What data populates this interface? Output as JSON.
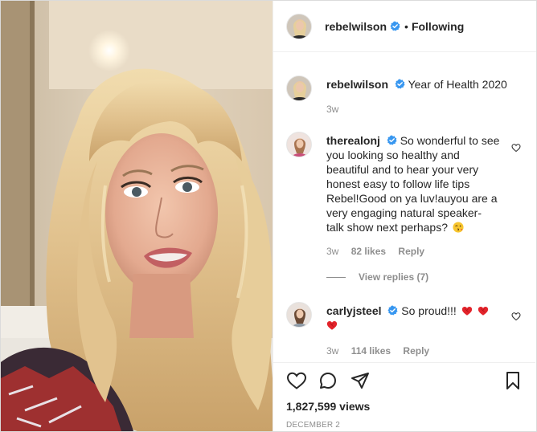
{
  "header": {
    "username": "rebelwilson",
    "separator": "•",
    "follow_label": "Following"
  },
  "caption": {
    "username": "rebelwilson",
    "text": "Year of Health 2020",
    "time": "3w"
  },
  "comments": [
    {
      "username": "therealonj",
      "text": "So wonderful to see you looking so healthy and beautiful and to hear your very honest easy to follow life tips Rebel!Good on ya luv!auyou are a very engaging natural speaker- talk show next perhaps?",
      "emoji": "winking-kiss-emoji",
      "time": "3w",
      "likes": "82 likes",
      "reply": "Reply",
      "view_replies": "View replies (7)"
    },
    {
      "username": "carlyjsteel",
      "text": "So proud!!!",
      "emoji": "red-heart-emoji",
      "time": "3w",
      "likes": "114 likes",
      "reply": "Reply"
    }
  ],
  "stats": {
    "views": "1,827,599 views",
    "date": "DECEMBER 2"
  },
  "colors": {
    "verified_blue": "#3897f0",
    "text_primary": "#262626",
    "text_secondary": "#8e8e8e",
    "heart_red": "#ed4956"
  },
  "icons": [
    "like-icon",
    "comment-icon",
    "share-icon",
    "save-icon",
    "verified-badge-icon",
    "small-heart-icon"
  ]
}
